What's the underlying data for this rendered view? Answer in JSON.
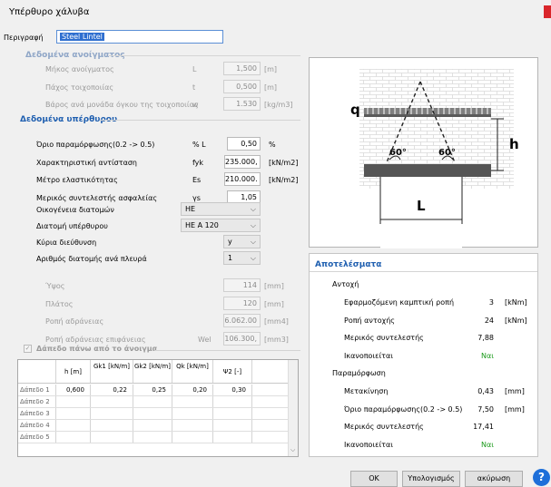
{
  "window": {
    "title": "Υπέρθυρο χάλυβα"
  },
  "description": {
    "label": "Περιγραφή",
    "value": "Steel Lintel"
  },
  "opening": {
    "header": "Δεδομένα ανοίγματος",
    "rows": [
      {
        "label": "Μήκος ανοίγματος",
        "sym": "L",
        "value": "1,500",
        "unit": "[m]"
      },
      {
        "label": "Πάχος τοιχοποιίας",
        "sym": "t",
        "value": "0,500",
        "unit": "[m]"
      },
      {
        "label": "Βάρος ανά μονάδα όγκου της τοιχοποιίας",
        "sym": "w",
        "value": "1.530",
        "unit": "[kg/m3]"
      }
    ]
  },
  "lintel": {
    "header": "Δεδομένα υπέρθυρου",
    "rows": [
      {
        "label": "Όριο παραμόρφωσης(0.2 -> 0.5)",
        "sym": "% L",
        "value": "0,50",
        "unit": "%"
      },
      {
        "label": "Χαρακτηριστική αντίσταση",
        "sym": "fyk",
        "value": "235.000,",
        "unit": "[kN/m2]"
      },
      {
        "label": "Μέτρο ελαστικότητας",
        "sym": "Es",
        "value": "210.000.",
        "unit": "[kN/m2]"
      },
      {
        "label": "Μερικός συντελεστής ασφαλείας",
        "sym": "γs",
        "value": "1,05",
        "unit": ""
      }
    ],
    "family_label": "Οικογένεια διατομών",
    "family_value": "HE",
    "section_label": "Διατομή υπέρθυρου",
    "section_value": "HE A 120",
    "axis_label": "Κύρια διεύθυνση",
    "axis_value": "y",
    "count_label": "Αριθμός διατομής ανά πλευρά",
    "count_value": "1",
    "props": [
      {
        "label": "Ύψος",
        "sym": "",
        "value": "114",
        "unit": "[mm]"
      },
      {
        "label": "Πλάτος",
        "sym": "",
        "value": "120",
        "unit": "[mm]"
      },
      {
        "label": "Ροπή αδράνειας",
        "sym": "",
        "value": "6.062.00",
        "unit": "[mm4]"
      },
      {
        "label": "Ροπή αδράνειας επιφάνειας",
        "sym": "Wel",
        "value": "106.300,",
        "unit": "[mm3]"
      }
    ]
  },
  "floors": {
    "checkbox_label": "Δάπεδο πάνω από το άνοιγμα",
    "checked": true,
    "headers": [
      "",
      "h [m]",
      "Gk1 [kN/m]",
      "Gk2 [kN/m]",
      "Qk [kN/m]",
      "Ψ2 [-]"
    ],
    "rows": [
      [
        "Δάπεδο 1",
        "0,600",
        "0,22",
        "0,25",
        "0,20",
        "0,30"
      ],
      [
        "Δάπεδο 2",
        "",
        "",
        "",
        "",
        ""
      ],
      [
        "Δάπεδο 3",
        "",
        "",
        "",
        "",
        ""
      ],
      [
        "Δάπεδο 4",
        "",
        "",
        "",
        "",
        ""
      ],
      [
        "Δάπεδο 5",
        "",
        "",
        "",
        "",
        ""
      ]
    ]
  },
  "diagram": {
    "q": "q",
    "h": "h",
    "L": "L",
    "angle_left": "60°",
    "angle_right": "60°"
  },
  "results": {
    "header": "Αποτελέσματα",
    "strength_title": "Αντοχή",
    "strength": [
      {
        "label": "Εφαρμοζόμενη καμπτική ροπή",
        "value": "3",
        "unit": "[kNm]"
      },
      {
        "label": "Ροπή αντοχής",
        "value": "24",
        "unit": "[kNm]"
      },
      {
        "label": "Μερικός συντελεστής",
        "value": "7,88",
        "unit": ""
      },
      {
        "label": "Ικανοποιείται",
        "value": "Ναι",
        "unit": ""
      }
    ],
    "deform_title": "Παραμόρφωση",
    "deform": [
      {
        "label": "Μετακίνηση",
        "value": "0,43",
        "unit": "[mm]"
      },
      {
        "label": "Όριο παραμόρφωσης(0.2 -> 0.5)",
        "value": "7,50",
        "unit": "[mm]"
      },
      {
        "label": "Μερικός συντελεστής",
        "value": "17,41",
        "unit": ""
      },
      {
        "label": "Ικανοποιείται",
        "value": "Ναι",
        "unit": ""
      }
    ],
    "ok_color": "#1a9a1a"
  },
  "buttons": {
    "ok": "OK",
    "calc": "Υπολογισμός",
    "cancel": "ακύρωση",
    "help": "?"
  }
}
